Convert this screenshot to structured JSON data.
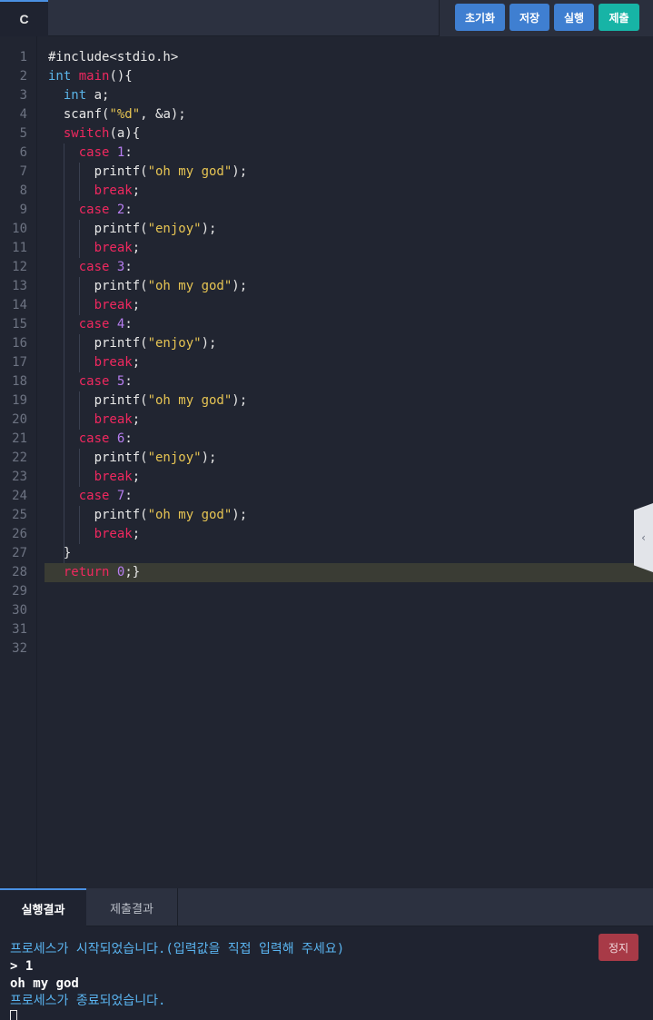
{
  "toolbar": {
    "language": "C",
    "reset_label": "초기화",
    "save_label": "저장",
    "run_label": "실행",
    "submit_label": "제출"
  },
  "editor": {
    "line_numbers": [
      "1",
      "2",
      "3",
      "4",
      "5",
      "6",
      "7",
      "8",
      "9",
      "10",
      "11",
      "12",
      "13",
      "14",
      "15",
      "16",
      "17",
      "18",
      "19",
      "20",
      "21",
      "22",
      "23",
      "24",
      "25",
      "26",
      "27",
      "28",
      "29",
      "30",
      "31",
      "32"
    ],
    "active_line": 28,
    "code_lines": [
      [
        {
          "t": "#include<stdio.h>",
          "c": ""
        }
      ],
      [
        {
          "t": "int",
          "c": "kw-blue"
        },
        {
          "t": " ",
          "c": ""
        },
        {
          "t": "main",
          "c": "kw-red"
        },
        {
          "t": "(){",
          "c": ""
        }
      ],
      [
        {
          "t": "  ",
          "c": ""
        },
        {
          "t": "int",
          "c": "kw-blue"
        },
        {
          "t": " a;",
          "c": ""
        }
      ],
      [
        {
          "t": "  scanf(",
          "c": ""
        },
        {
          "t": "\"%d\"",
          "c": "str"
        },
        {
          "t": ", &a);",
          "c": ""
        }
      ],
      [
        {
          "t": "  ",
          "c": ""
        },
        {
          "t": "switch",
          "c": "kw-red"
        },
        {
          "t": "(a){",
          "c": ""
        }
      ],
      [
        {
          "t": "    ",
          "c": ""
        },
        {
          "t": "case",
          "c": "kw-red"
        },
        {
          "t": " ",
          "c": ""
        },
        {
          "t": "1",
          "c": "kw-num"
        },
        {
          "t": ":",
          "c": ""
        }
      ],
      [
        {
          "t": "      printf(",
          "c": ""
        },
        {
          "t": "\"oh my god\"",
          "c": "str"
        },
        {
          "t": ");",
          "c": ""
        }
      ],
      [
        {
          "t": "      ",
          "c": ""
        },
        {
          "t": "break",
          "c": "kw-red"
        },
        {
          "t": ";",
          "c": ""
        }
      ],
      [
        {
          "t": "    ",
          "c": ""
        },
        {
          "t": "case",
          "c": "kw-red"
        },
        {
          "t": " ",
          "c": ""
        },
        {
          "t": "2",
          "c": "kw-num"
        },
        {
          "t": ":",
          "c": ""
        }
      ],
      [
        {
          "t": "      printf(",
          "c": ""
        },
        {
          "t": "\"enjoy\"",
          "c": "str"
        },
        {
          "t": ");",
          "c": ""
        }
      ],
      [
        {
          "t": "      ",
          "c": ""
        },
        {
          "t": "break",
          "c": "kw-red"
        },
        {
          "t": ";",
          "c": ""
        }
      ],
      [
        {
          "t": "    ",
          "c": ""
        },
        {
          "t": "case",
          "c": "kw-red"
        },
        {
          "t": " ",
          "c": ""
        },
        {
          "t": "3",
          "c": "kw-num"
        },
        {
          "t": ":",
          "c": ""
        }
      ],
      [
        {
          "t": "      printf(",
          "c": ""
        },
        {
          "t": "\"oh my god\"",
          "c": "str"
        },
        {
          "t": ");",
          "c": ""
        }
      ],
      [
        {
          "t": "      ",
          "c": ""
        },
        {
          "t": "break",
          "c": "kw-red"
        },
        {
          "t": ";",
          "c": ""
        }
      ],
      [
        {
          "t": "    ",
          "c": ""
        },
        {
          "t": "case",
          "c": "kw-red"
        },
        {
          "t": " ",
          "c": ""
        },
        {
          "t": "4",
          "c": "kw-num"
        },
        {
          "t": ":",
          "c": ""
        }
      ],
      [
        {
          "t": "      printf(",
          "c": ""
        },
        {
          "t": "\"enjoy\"",
          "c": "str"
        },
        {
          "t": ");",
          "c": ""
        }
      ],
      [
        {
          "t": "      ",
          "c": ""
        },
        {
          "t": "break",
          "c": "kw-red"
        },
        {
          "t": ";",
          "c": ""
        }
      ],
      [
        {
          "t": "    ",
          "c": ""
        },
        {
          "t": "case",
          "c": "kw-red"
        },
        {
          "t": " ",
          "c": ""
        },
        {
          "t": "5",
          "c": "kw-num"
        },
        {
          "t": ":",
          "c": ""
        }
      ],
      [
        {
          "t": "      printf(",
          "c": ""
        },
        {
          "t": "\"oh my god\"",
          "c": "str"
        },
        {
          "t": ");",
          "c": ""
        }
      ],
      [
        {
          "t": "      ",
          "c": ""
        },
        {
          "t": "break",
          "c": "kw-red"
        },
        {
          "t": ";",
          "c": ""
        }
      ],
      [
        {
          "t": "    ",
          "c": ""
        },
        {
          "t": "case",
          "c": "kw-red"
        },
        {
          "t": " ",
          "c": ""
        },
        {
          "t": "6",
          "c": "kw-num"
        },
        {
          "t": ":",
          "c": ""
        }
      ],
      [
        {
          "t": "      printf(",
          "c": ""
        },
        {
          "t": "\"enjoy\"",
          "c": "str"
        },
        {
          "t": ");",
          "c": ""
        }
      ],
      [
        {
          "t": "      ",
          "c": ""
        },
        {
          "t": "break",
          "c": "kw-red"
        },
        {
          "t": ";",
          "c": ""
        }
      ],
      [
        {
          "t": "    ",
          "c": ""
        },
        {
          "t": "case",
          "c": "kw-red"
        },
        {
          "t": " ",
          "c": ""
        },
        {
          "t": "7",
          "c": "kw-num"
        },
        {
          "t": ":",
          "c": ""
        }
      ],
      [
        {
          "t": "      printf(",
          "c": ""
        },
        {
          "t": "\"oh my god\"",
          "c": "str"
        },
        {
          "t": ");",
          "c": ""
        }
      ],
      [
        {
          "t": "      ",
          "c": ""
        },
        {
          "t": "break",
          "c": "kw-red"
        },
        {
          "t": ";",
          "c": ""
        }
      ],
      [
        {
          "t": "  }",
          "c": ""
        }
      ],
      [
        {
          "t": "  ",
          "c": ""
        },
        {
          "t": "return",
          "c": "kw-red"
        },
        {
          "t": " ",
          "c": ""
        },
        {
          "t": "0",
          "c": "kw-num"
        },
        {
          "t": ";}",
          "c": ""
        }
      ],
      [],
      [],
      [],
      []
    ]
  },
  "panel": {
    "tab_run": "실행결과",
    "tab_submit": "제출결과",
    "stop_label": "정지",
    "console_lines": [
      {
        "text": "프로세스가 시작되었습니다.(입력값을 직접 입력해 주세요)",
        "kind": "c-info"
      },
      {
        "text": "> 1",
        "kind": "c-out"
      },
      {
        "text": "oh my god",
        "kind": "c-out"
      },
      {
        "text": "프로세스가 종료되었습니다.",
        "kind": "c-info"
      }
    ]
  },
  "colors": {
    "accent": "#3f7fd1",
    "submit": "#17b4a6",
    "stop": "#a83a47",
    "keyword_red": "#f0285f",
    "keyword_blue": "#5ab4e8",
    "string": "#e6c453",
    "number": "#b77ef0"
  },
  "icons": {
    "collapse_handle": "chevron-left-icon"
  }
}
